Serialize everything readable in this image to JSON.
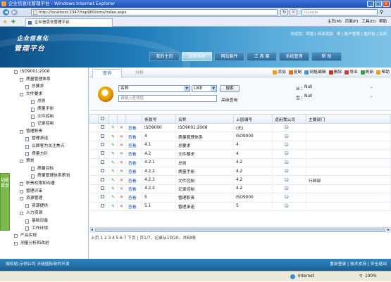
{
  "window": {
    "title": "企业信息化管理平台 - Windows Internet Explorer"
  },
  "addressbar": {
    "url": "http://localhost:2347/hsp900/oms/index.aspx",
    "search_placeholder": "Google"
  },
  "browser_tab": {
    "label": "企业信息化管理平台"
  },
  "browser_tools": [
    "主页(M)",
    "页面(P)",
    "工具(O)",
    "帮助"
  ],
  "header": {
    "logo_line1": "企业信息化",
    "logo_line2": "管理平台",
    "user_text": "欢迎您：阿智1 待读消息:",
    "message_count": "0",
    "user_links": "条 | 账户管理 | 插件包 | 关闭",
    "nav": [
      "我的主页",
      "业务系统",
      "网站套件",
      "工 具 箱",
      "系统管理",
      "帮 助"
    ],
    "active_nav": 1
  },
  "sidebar": {
    "handle_label": "功能菜单",
    "tree": [
      {
        "label": "ISO9001:2008",
        "level": 0,
        "type": "box"
      },
      {
        "label": "质量管理体系",
        "level": 1,
        "type": "box"
      },
      {
        "label": "总要求",
        "level": 2,
        "type": "file"
      },
      {
        "label": "文件要求",
        "level": 1,
        "type": "box"
      },
      {
        "label": "总则",
        "level": 3,
        "type": "file"
      },
      {
        "label": "质量手册",
        "level": 3,
        "type": "file"
      },
      {
        "label": "文件控制",
        "level": 3,
        "type": "file"
      },
      {
        "label": "记录控制",
        "level": 3,
        "type": "file"
      },
      {
        "label": "管理职责",
        "level": 1,
        "type": "box"
      },
      {
        "label": "管理承诺",
        "level": 2,
        "type": "file"
      },
      {
        "label": "以顾客为关注焦点",
        "level": 2,
        "type": "file"
      },
      {
        "label": "质量方针",
        "level": 2,
        "type": "file"
      },
      {
        "label": "策划",
        "level": 1,
        "type": "box"
      },
      {
        "label": "质量目标",
        "level": 3,
        "type": "file"
      },
      {
        "label": "质量管理体系策划",
        "level": 3,
        "type": "file"
      },
      {
        "label": "职责权限和沟通",
        "level": 1,
        "type": "box"
      },
      {
        "label": "管理评审",
        "level": 1,
        "type": "box"
      },
      {
        "label": "资源管理",
        "level": 1,
        "type": "box"
      },
      {
        "label": "资源提供",
        "level": 2,
        "type": "file"
      },
      {
        "label": "人力资源",
        "level": 1,
        "type": "box"
      },
      {
        "label": "基础设备",
        "level": 2,
        "type": "file"
      },
      {
        "label": "工作环境",
        "level": 2,
        "type": "file"
      },
      {
        "label": "产品实现",
        "level": 0,
        "type": "box"
      },
      {
        "label": "测量分析和改进",
        "level": 0,
        "type": "box"
      }
    ]
  },
  "subtabs": [
    "查询",
    "分析"
  ],
  "actions": [
    {
      "label": "添加",
      "color": "#f0a020"
    },
    {
      "label": "复制",
      "color": "#e07020"
    },
    {
      "label": "网格编辑",
      "color": "#5090d0"
    },
    {
      "label": "删除",
      "color": "#d03020"
    },
    {
      "label": "导出",
      "color": "#d04040"
    },
    {
      "label": "刷新",
      "color": "#30a040"
    },
    {
      "label": "帮助",
      "color": "#f0a020"
    }
  ],
  "search": {
    "field": "名称",
    "operator": "LIKE",
    "search_button": "搜索",
    "input_placeholder": "请输入查找值",
    "advanced_label": "高级查询",
    "from_label": "从：",
    "from_value": "Null",
    "to_label": "至：",
    "to_value": "Null"
  },
  "table": {
    "columns": [
      "",
      "",
      "",
      "",
      "条款号",
      "名称",
      "上层编号",
      "适用我公司",
      "主要部门"
    ],
    "view_label": "查看",
    "rows": [
      {
        "clause": "ISO9000",
        "name": "ISO9001:2008",
        "parent": "(无)",
        "applicable": true,
        "dept": ""
      },
      {
        "clause": "4",
        "name": "质量管理体系",
        "parent": "ISO9000",
        "applicable": true,
        "dept": ""
      },
      {
        "clause": "4.1",
        "name": "总要求",
        "parent": "4",
        "applicable": true,
        "dept": ""
      },
      {
        "clause": "4.2",
        "name": "文件要求",
        "parent": "4",
        "applicable": true,
        "dept": ""
      },
      {
        "clause": "4.2.1",
        "name": "总则",
        "parent": "4.2",
        "applicable": true,
        "dept": ""
      },
      {
        "clause": "4.2.2",
        "name": "质量手册",
        "parent": "4.2",
        "applicable": true,
        "dept": ""
      },
      {
        "clause": "4.2.3",
        "name": "文件控制",
        "parent": "4.2",
        "applicable": true,
        "dept": "行政部"
      },
      {
        "clause": "4.2.4",
        "name": "记录控制",
        "parent": "4.2",
        "applicable": true,
        "dept": ""
      },
      {
        "clause": "5",
        "name": "管理职责",
        "parent": "ISO9000",
        "applicable": true,
        "dept": ""
      },
      {
        "clause": "5.1",
        "name": "管理承诺",
        "parent": "5",
        "applicable": true,
        "dept": ""
      }
    ]
  },
  "pager": {
    "text": "上页 1 2 3 4 5 6 7 下页 | 页1/7，记录从1到10，共68条"
  },
  "footer": {
    "left": "授权给:示例公司 天极国际软件开发",
    "right": "重新登录 | 技术支持 | 安全退出"
  },
  "statusbar": {
    "zone": "Internet",
    "zoom": "100%"
  }
}
